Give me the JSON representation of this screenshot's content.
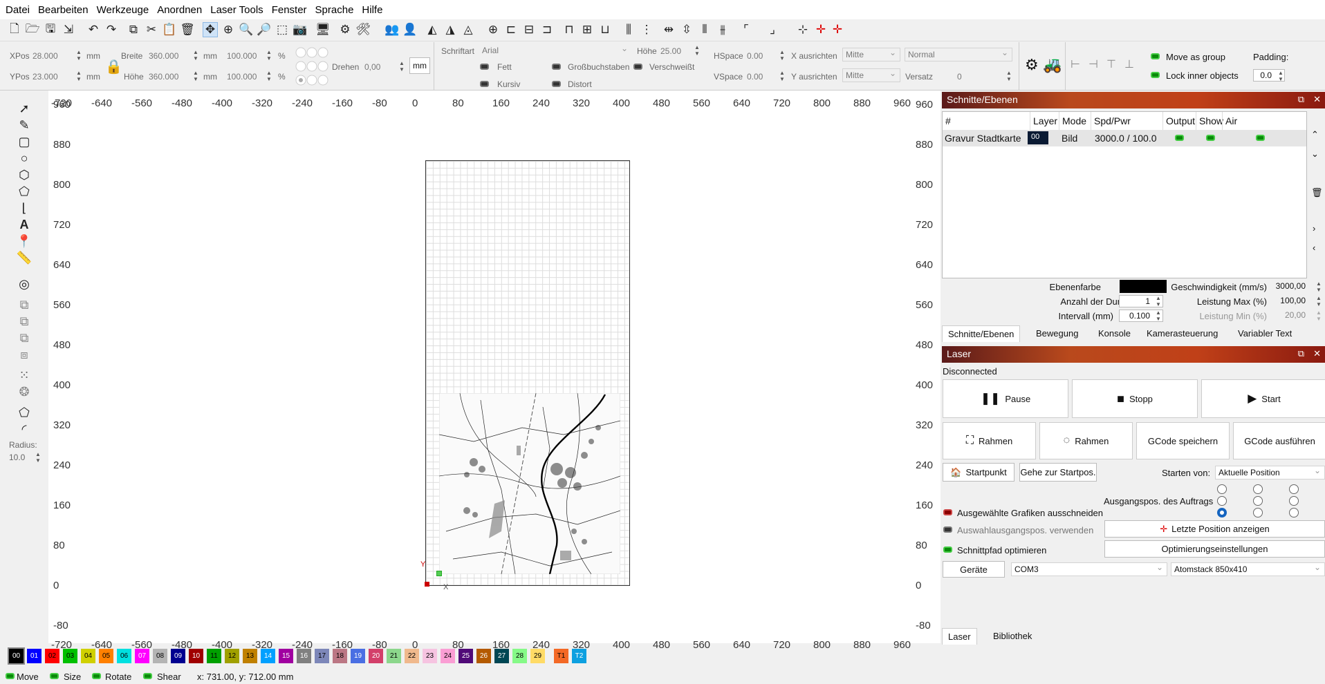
{
  "menu": [
    "Datei",
    "Bearbeiten",
    "Werkzeuge",
    "Anordnen",
    "Laser Tools",
    "Fenster",
    "Sprache",
    "Hilfe"
  ],
  "props": {
    "xpos_label": "XPos",
    "xpos": "28.000",
    "ypos_label": "YPos",
    "ypos": "23.000",
    "unit": "mm",
    "breite_label": "Breite",
    "breite": "360.000",
    "hoehe_label": "Höhe",
    "hoehe": "360.000",
    "scale_w": "100.000",
    "scale_h": "100.000",
    "pct": "%",
    "drehen_label": "Drehen",
    "drehen": "0,00",
    "mm_button": "mm",
    "schriftart_label": "Schriftart",
    "schriftart": "Arial",
    "font_hoehe_label": "Höhe",
    "font_hoehe": "25.00",
    "hspace_label": "HSpace",
    "hspace": "0.00",
    "vspace_label": "VSpace",
    "vspace": "0.00",
    "x_ausrichten_label": "X ausrichten",
    "x_ausrichten": "Mitte",
    "y_ausrichten_label": "Y ausrichten",
    "y_ausrichten": "Mitte",
    "normal": "Normal",
    "versatz_label": "Versatz",
    "versatz": "0",
    "fett": "Fett",
    "kursiv": "Kursiv",
    "gross": "Großbuchstaben",
    "distort": "Distort",
    "verschweisst": "Verschweißt",
    "move_group": "Move as group",
    "lock_inner": "Lock inner objects",
    "padding_label": "Padding:",
    "padding": "0.0"
  },
  "left": {
    "radius_label": "Radius:",
    "radius": "10.0"
  },
  "ruler": {
    "top": [
      "-720",
      "-640",
      "-560",
      "-480",
      "-400",
      "-320",
      "-240",
      "-160",
      "-80",
      "0",
      "80",
      "160",
      "240",
      "320",
      "400",
      "480",
      "560",
      "640",
      "720",
      "800",
      "880",
      "960"
    ],
    "left": [
      "960",
      "880",
      "800",
      "720",
      "640",
      "560",
      "480",
      "400",
      "320",
      "240",
      "160",
      "80",
      "0",
      "-80"
    ],
    "axis_y": "Y",
    "axis_x": "X"
  },
  "cuts": {
    "title": "Schnitte/Ebenen",
    "headers": [
      "#",
      "Layer",
      "Mode",
      "Spd/Pwr",
      "Output",
      "Show",
      "Air"
    ],
    "row": {
      "name": "Gravur Stadtkarte",
      "layer": "00",
      "mode": "Bild",
      "spdpwr": "3000.0 / 100.0"
    },
    "ebenenfarbe_label": "Ebenenfarbe",
    "durchlaeufe_label": "Anzahl der Durchläufe",
    "durchlaeufe": "1",
    "intervall_label": "Intervall (mm)",
    "intervall": "0.100",
    "geschw_label": "Geschwindigkeit (mm/s)",
    "geschw": "3000,00",
    "lmax_label": "Leistung Max (%)",
    "lmax": "100,00",
    "lmin_label": "Leistung Min (%)",
    "lmin": "20,00",
    "tabs": [
      "Schnitte/Ebenen",
      "Bewegung",
      "Konsole",
      "Kamerasteuerung",
      "Variabler Text"
    ]
  },
  "laser": {
    "title": "Laser",
    "status": "Disconnected",
    "pause": "Pause",
    "stopp": "Stopp",
    "start": "Start",
    "rahmen1": "Rahmen",
    "rahmen2": "Rahmen",
    "gcode_save": "GCode speichern",
    "gcode_run": "GCode ausführen",
    "startpunkt": "Startpunkt",
    "gehe": "Gehe zur Startpos.",
    "starten_label": "Starten von:",
    "starten": "Aktuelle Position",
    "ausgangspos": "Ausgangspos. des Auftrags",
    "opt1": "Ausgewählte Grafiken ausschneiden",
    "opt2": "Auswahlausgangspos. verwenden",
    "opt3": "Schnittpfad optimieren",
    "letzte": "Letzte Position anzeigen",
    "optimierung": "Optimierungseinstellungen",
    "geraete": "Geräte",
    "port": "COM3",
    "machine": "Atomstack 850x410",
    "tabs": [
      "Laser",
      "Bibliothek"
    ]
  },
  "palette": [
    {
      "l": "00",
      "c": "#000000",
      "t": "#fff"
    },
    {
      "l": "01",
      "c": "#0000ff",
      "t": "#fff"
    },
    {
      "l": "02",
      "c": "#ff0000",
      "t": "#000"
    },
    {
      "l": "03",
      "c": "#00c000",
      "t": "#000"
    },
    {
      "l": "04",
      "c": "#d0d000",
      "t": "#000"
    },
    {
      "l": "05",
      "c": "#ff8000",
      "t": "#000"
    },
    {
      "l": "06",
      "c": "#00e0e0",
      "t": "#000"
    },
    {
      "l": "07",
      "c": "#ff00ff",
      "t": "#fff"
    },
    {
      "l": "08",
      "c": "#b4b4b4",
      "t": "#000"
    },
    {
      "l": "09",
      "c": "#000090",
      "t": "#fff"
    },
    {
      "l": "10",
      "c": "#a00000",
      "t": "#fff"
    },
    {
      "l": "11",
      "c": "#00a000",
      "t": "#000"
    },
    {
      "l": "12",
      "c": "#a0a000",
      "t": "#000"
    },
    {
      "l": "13",
      "c": "#c08000",
      "t": "#000"
    },
    {
      "l": "14",
      "c": "#00a0ff",
      "t": "#fff"
    },
    {
      "l": "15",
      "c": "#a000a0",
      "t": "#fff"
    },
    {
      "l": "16",
      "c": "#808080",
      "t": "#fff"
    },
    {
      "l": "17",
      "c": "#7d87b9",
      "t": "#000"
    },
    {
      "l": "18",
      "c": "#bb7784",
      "t": "#000"
    },
    {
      "l": "19",
      "c": "#4a6fe3",
      "t": "#fff"
    },
    {
      "l": "20",
      "c": "#d33f6a",
      "t": "#fff"
    },
    {
      "l": "21",
      "c": "#8cd78c",
      "t": "#000"
    },
    {
      "l": "22",
      "c": "#f0b98d",
      "t": "#000"
    },
    {
      "l": "23",
      "c": "#f6c4e1",
      "t": "#000"
    },
    {
      "l": "24",
      "c": "#fa9ed4",
      "t": "#000"
    },
    {
      "l": "25",
      "c": "#500a78",
      "t": "#fff"
    },
    {
      "l": "26",
      "c": "#b45a00",
      "t": "#fff"
    },
    {
      "l": "27",
      "c": "#004754",
      "t": "#fff"
    },
    {
      "l": "28",
      "c": "#86fa88",
      "t": "#000"
    },
    {
      "l": "29",
      "c": "#ffdb66",
      "t": "#000"
    },
    {
      "l": "T1",
      "c": "#f36926",
      "t": "#000"
    },
    {
      "l": "T2",
      "c": "#0ea0e0",
      "t": "#fff"
    }
  ],
  "status": {
    "move": "Move",
    "size": "Size",
    "rotate": "Rotate",
    "shear": "Shear",
    "coords": "x: 731.00, y: 712.00 mm"
  }
}
